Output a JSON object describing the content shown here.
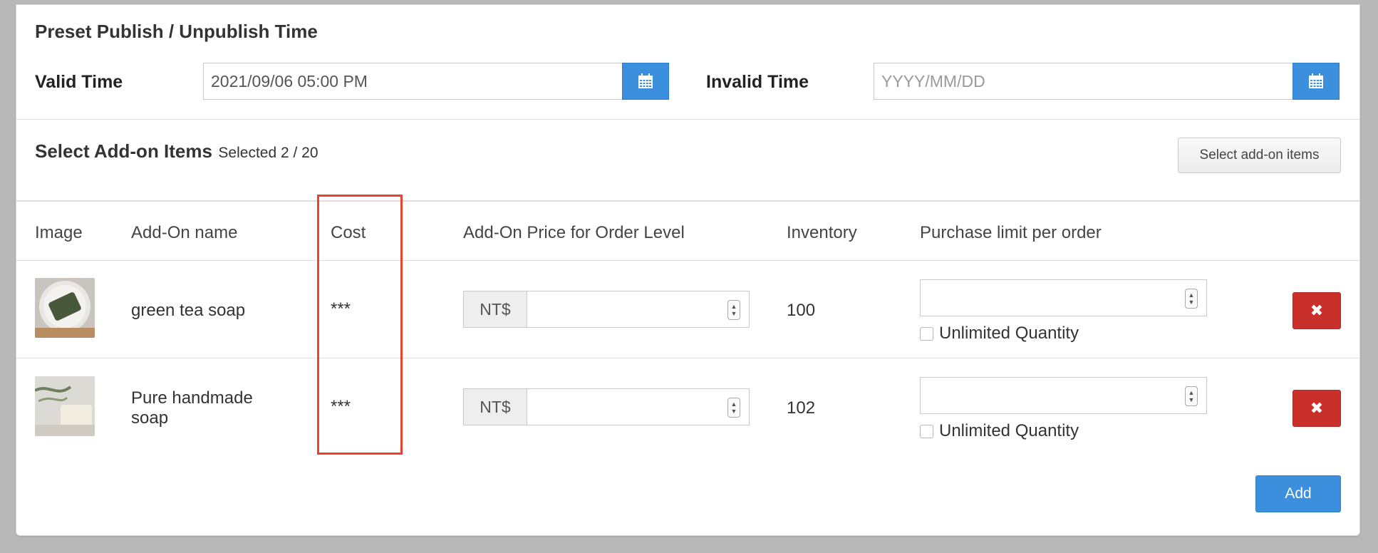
{
  "publish": {
    "title": "Preset Publish / Unpublish Time",
    "valid_label": "Valid Time",
    "valid_value": "2021/09/06 05:00 PM",
    "invalid_label": "Invalid Time",
    "invalid_placeholder": "YYYY/MM/DD"
  },
  "addons": {
    "title": "Select Add-on Items",
    "selected_text": "Selected 2 / 20",
    "select_button": "Select add-on items",
    "columns": {
      "image": "Image",
      "name": "Add-On name",
      "cost": "Cost",
      "price": "Add-On Price for Order Level",
      "inventory": "Inventory",
      "limit": "Purchase limit per order"
    },
    "rows": [
      {
        "name_line1": "green tea soap",
        "name_line2": "",
        "cost": "***",
        "currency": "NT$",
        "inventory": "100",
        "unlimited_label": "Unlimited Quantity",
        "delete_glyph": "✖"
      },
      {
        "name_line1": "Pure handmade",
        "name_line2": "soap",
        "cost": "***",
        "currency": "NT$",
        "inventory": "102",
        "unlimited_label": "Unlimited Quantity",
        "delete_glyph": "✖"
      }
    ],
    "add_button": "Add"
  },
  "colors": {
    "primary": "#3b8fdc",
    "danger": "#c9302c",
    "highlight": "#e8432f"
  }
}
